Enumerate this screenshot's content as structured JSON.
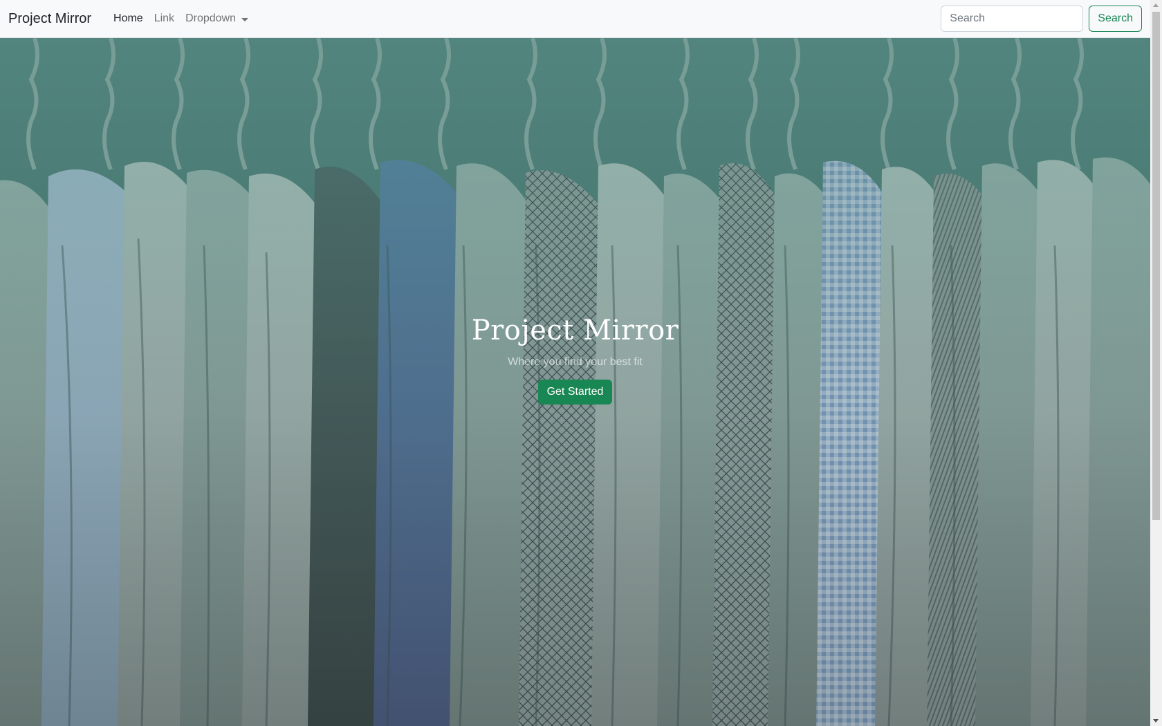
{
  "navbar": {
    "brand": "Project Mirror",
    "links": [
      {
        "label": "Home",
        "active": true
      },
      {
        "label": "Link",
        "active": false
      },
      {
        "label": "Dropdown",
        "active": false
      }
    ],
    "search": {
      "placeholder": "Search",
      "value": "",
      "button_label": "Search"
    }
  },
  "hero": {
    "title": "Project Mirror",
    "subtitle": "Where you find your best fit",
    "cta_label": "Get Started"
  },
  "colors": {
    "accent": "#198754",
    "navbar_bg": "#f8f9fa",
    "hero_tint": "#4d7c77"
  },
  "icons": {
    "dropdown": "caret-down-icon"
  }
}
